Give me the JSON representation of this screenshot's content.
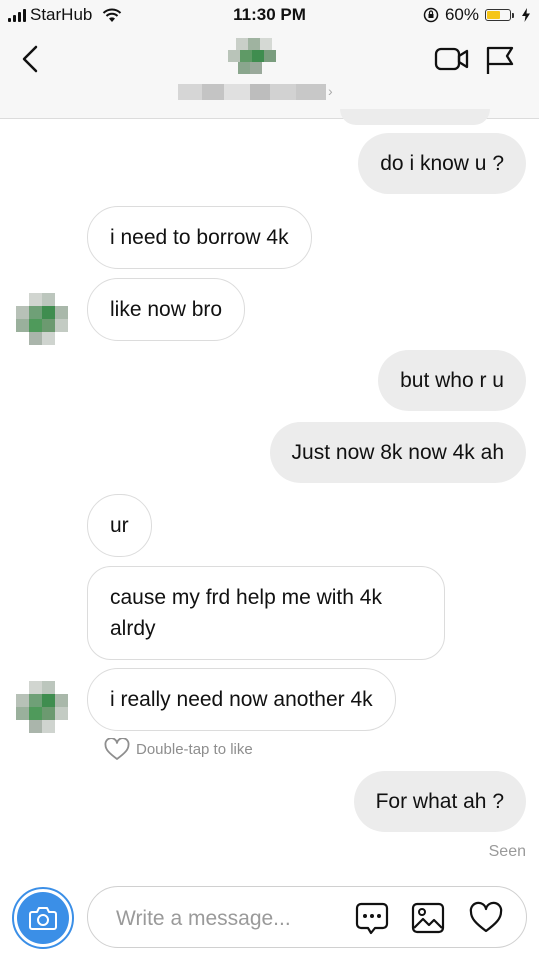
{
  "status_bar": {
    "carrier": "StarHub",
    "time": "11:30 PM",
    "battery": "60%",
    "battery_level": 0.6,
    "icons": [
      "signal-icon",
      "wifi-icon",
      "orientation-lock-icon",
      "battery-icon",
      "charging-icon"
    ]
  },
  "header": {
    "icons": [
      "back-chevron-icon",
      "video-call-icon",
      "flag-icon"
    ],
    "chevron": "›"
  },
  "messages": [
    {
      "id": "m1",
      "direction": "outgoing",
      "text": "do i know u ?"
    },
    {
      "id": "m2",
      "direction": "incoming",
      "text": "i need to borrow 4k"
    },
    {
      "id": "m3",
      "direction": "incoming",
      "text": "like now bro"
    },
    {
      "id": "m4",
      "direction": "outgoing",
      "text": "but who r u"
    },
    {
      "id": "m5",
      "direction": "outgoing",
      "text": "Just now 8k now 4k ah"
    },
    {
      "id": "m6",
      "direction": "incoming",
      "text": "ur"
    },
    {
      "id": "m7",
      "direction": "incoming",
      "text": "cause my frd help me with 4k alrdy"
    },
    {
      "id": "m8",
      "direction": "incoming",
      "text": "i really need now another 4k"
    },
    {
      "id": "m9",
      "direction": "outgoing",
      "text": "For what ah ?"
    }
  ],
  "like_hint": "Double-tap to like",
  "seen_label": "Seen",
  "composer": {
    "placeholder": "Write a message...",
    "value": "",
    "icons": [
      "camera-icon",
      "chat-bubble-icon",
      "gallery-icon",
      "heart-icon"
    ]
  },
  "colors": {
    "accent_blue": "#3b8fe7",
    "outgoing_bubble": "#ececec",
    "incoming_border": "#dcdcdc",
    "battery_fill": "#f5c518"
  }
}
